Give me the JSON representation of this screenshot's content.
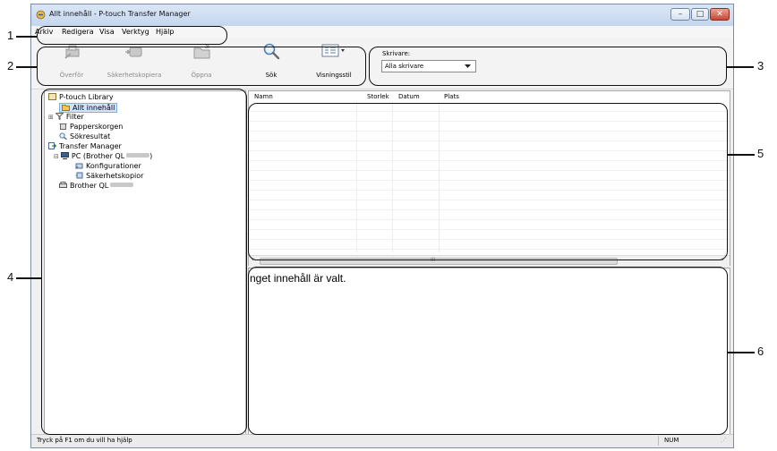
{
  "window": {
    "title": "Allt innehåll - P-touch Transfer Manager",
    "minimize_glyph": "–",
    "maximize_glyph": "□",
    "close_glyph": "✕"
  },
  "menu": [
    "Arkiv",
    "Redigera",
    "Visa",
    "Verktyg",
    "Hjälp"
  ],
  "toolbar": {
    "transfer": {
      "label": "Överför",
      "icon": "printer-transfer-icon"
    },
    "backup": {
      "label": "Säkerhetskopiera",
      "icon": "backup-device-icon"
    },
    "open": {
      "label": "Öppna",
      "icon": "open-folder-icon"
    },
    "search": {
      "label": "Sök",
      "icon": "magnifier-icon"
    },
    "view_style": {
      "label": "Visningsstil",
      "icon": "view-style-icon"
    },
    "printer_label": "Skrivare:",
    "printer_selected": "Alla skrivare"
  },
  "tree": {
    "library": "P-touch Library",
    "all_content": "Allt innehåll",
    "filter": "Filter",
    "trash": "Papperskorgen",
    "search_results": "Sökresultat",
    "transfer_manager": "Transfer Manager",
    "pc": "PC (Brother QL",
    "configurations": "Konfigurationer",
    "backups": "Säkerhetskopior",
    "printer": "Brother QL"
  },
  "list": {
    "columns": [
      "Namn",
      "Storlek",
      "Datum",
      "Plats"
    ],
    "scroll_mark": "III"
  },
  "preview": {
    "empty_text": "nget innehåll är valt."
  },
  "status": {
    "help_text": "Tryck på F1 om du vill ha hjälp",
    "num": "NUM"
  },
  "callouts": [
    "1",
    "2",
    "3",
    "4",
    "5",
    "6"
  ],
  "colors": {
    "selection": "#cce4ff",
    "titlebar": "#c4d6ee",
    "close": "#c74633"
  }
}
